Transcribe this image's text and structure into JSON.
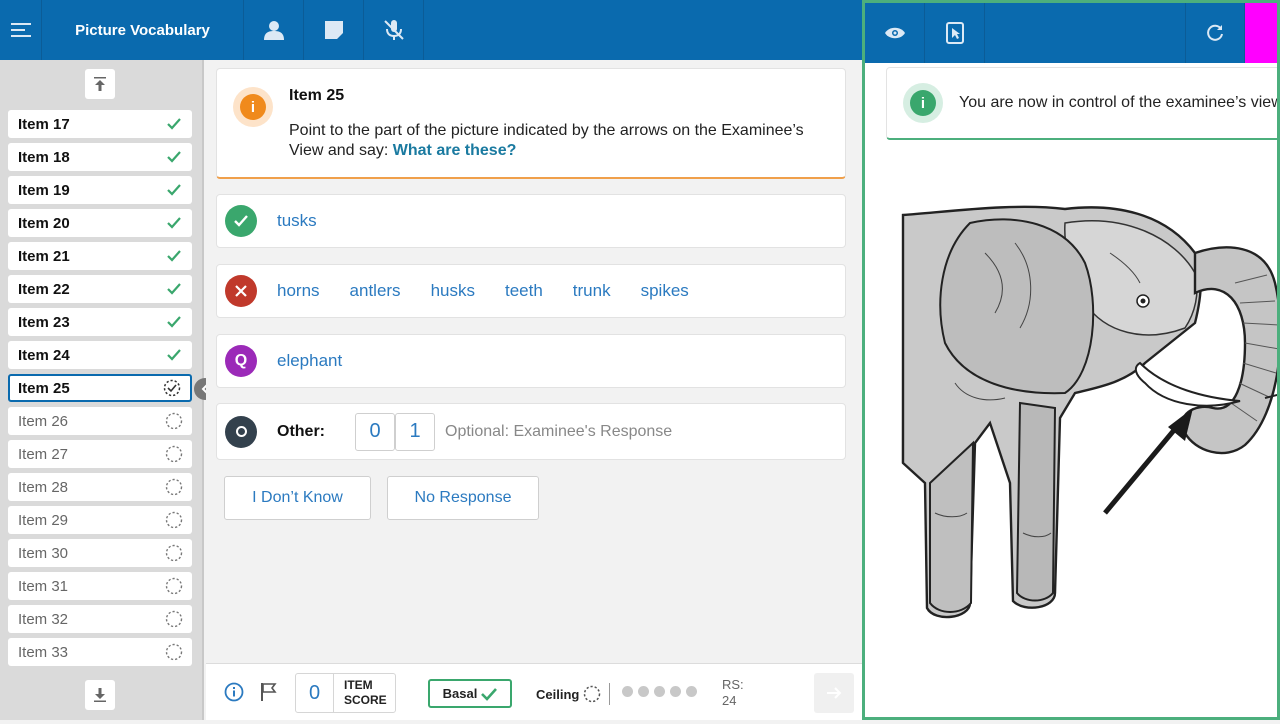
{
  "app": {
    "title": "Picture Vocabulary"
  },
  "sidebar": {
    "items": [
      {
        "label": "Item 17",
        "status": "done"
      },
      {
        "label": "Item 18",
        "status": "done"
      },
      {
        "label": "Item 19",
        "status": "done"
      },
      {
        "label": "Item 20",
        "status": "done"
      },
      {
        "label": "Item 21",
        "status": "done"
      },
      {
        "label": "Item 22",
        "status": "done"
      },
      {
        "label": "Item 23",
        "status": "done"
      },
      {
        "label": "Item 24",
        "status": "done"
      },
      {
        "label": "Item 25",
        "status": "current"
      },
      {
        "label": "Item 26",
        "status": "todo"
      },
      {
        "label": "Item 27",
        "status": "todo"
      },
      {
        "label": "Item 28",
        "status": "todo"
      },
      {
        "label": "Item 29",
        "status": "todo"
      },
      {
        "label": "Item 30",
        "status": "todo"
      },
      {
        "label": "Item 31",
        "status": "todo"
      },
      {
        "label": "Item 32",
        "status": "todo"
      },
      {
        "label": "Item 33",
        "status": "todo"
      }
    ]
  },
  "prompt": {
    "title": "Item 25",
    "text": "Point to the part of the picture indicated by the arrows on the Examinee’s View and say:",
    "question": "What are these?"
  },
  "responses": {
    "correct": [
      "tusks"
    ],
    "incorrect": [
      "horns",
      "antlers",
      "husks",
      "teeth",
      "trunk",
      "spikes"
    ],
    "query": [
      "elephant"
    ],
    "other_label": "Other:",
    "other_score_0": "0",
    "other_score_1": "1",
    "other_placeholder": "Optional: Examinee's Response"
  },
  "buttons": {
    "dont_know": "I Don’t Know",
    "no_response": "No Response"
  },
  "bottombar": {
    "item_score_value": "0",
    "item_score_label_1": "ITEM",
    "item_score_label_2": "SCORE",
    "basal": "Basal",
    "ceiling": "Ceiling",
    "rs_label": "RS:",
    "rs_value": "24"
  },
  "examinee_view": {
    "notice": "You are now in control of the examinee’s view"
  },
  "colors": {
    "brand": "#0a6aae",
    "correct": "#3aa76d",
    "incorrect": "#c0392b",
    "query": "#9b2ab8",
    "prompt_accent": "#f08a1c"
  }
}
